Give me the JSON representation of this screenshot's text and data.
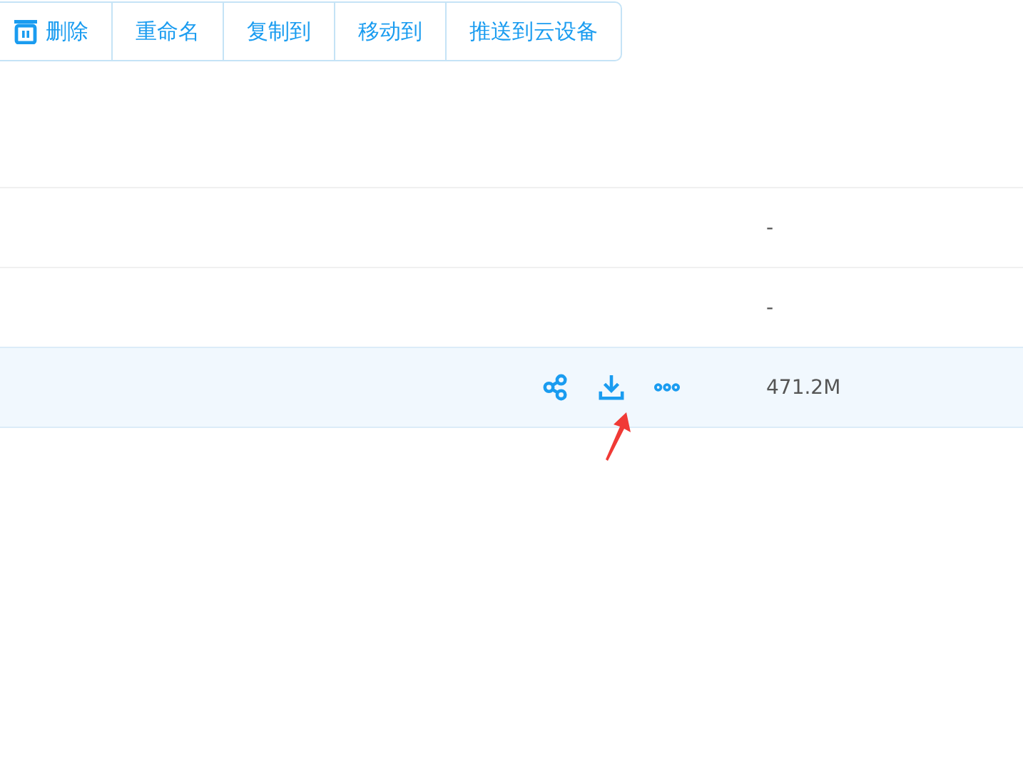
{
  "toolbar": [
    {
      "label": "删除",
      "kind": "delete"
    },
    {
      "label": "重命名",
      "kind": "plain"
    },
    {
      "label": "复制到",
      "kind": "plain"
    },
    {
      "label": "移动到",
      "kind": "plain"
    },
    {
      "label": "推送到云设备",
      "kind": "plain"
    }
  ],
  "rows": [
    {
      "size": "-",
      "selected": false
    },
    {
      "size": "-",
      "selected": false
    },
    {
      "size": "471.2M",
      "selected": true
    }
  ]
}
